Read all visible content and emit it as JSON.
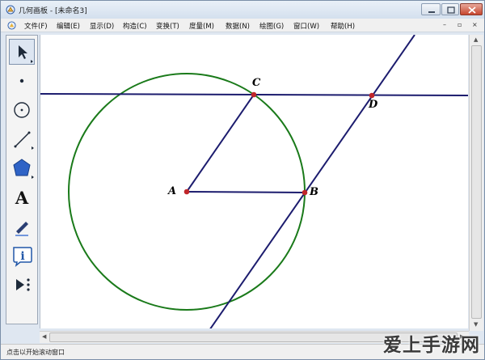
{
  "window": {
    "title": "几何画板 - [未命名3]"
  },
  "title_buttons": {
    "minimize": "minimize-icon",
    "maximize": "maximize-icon",
    "close": "close-icon"
  },
  "menu": {
    "items": [
      "文件(F)",
      "编辑(E)",
      "显示(D)",
      "构造(C)",
      "变换(T)",
      "度量(M)",
      "数据(N)",
      "绘图(G)",
      "窗口(W)",
      "帮助(H)"
    ],
    "controls": [
      "–",
      "▫",
      "×"
    ]
  },
  "toolbox": {
    "tools": [
      {
        "name": "select-arrow-tool-icon",
        "selected": true
      },
      {
        "name": "point-tool-icon"
      },
      {
        "name": "compass-tool-icon"
      },
      {
        "name": "straightedge-tool-icon"
      },
      {
        "name": "polygon-tool-icon"
      },
      {
        "name": "text-tool-icon",
        "glyph": "A"
      },
      {
        "name": "marker-tool-icon"
      },
      {
        "name": "information-tool-icon"
      },
      {
        "name": "custom-tools-icon"
      }
    ]
  },
  "canvas": {
    "points": [
      {
        "label": "A"
      },
      {
        "label": "B"
      },
      {
        "label": "C"
      },
      {
        "label": "D"
      }
    ],
    "colors": {
      "circle": "#1a7a1a",
      "line": "#1c1c6e",
      "point": "#c0262a"
    }
  },
  "status": {
    "text": "点击以开始滚动窗口"
  },
  "watermark": {
    "text": "爱上手游网"
  }
}
